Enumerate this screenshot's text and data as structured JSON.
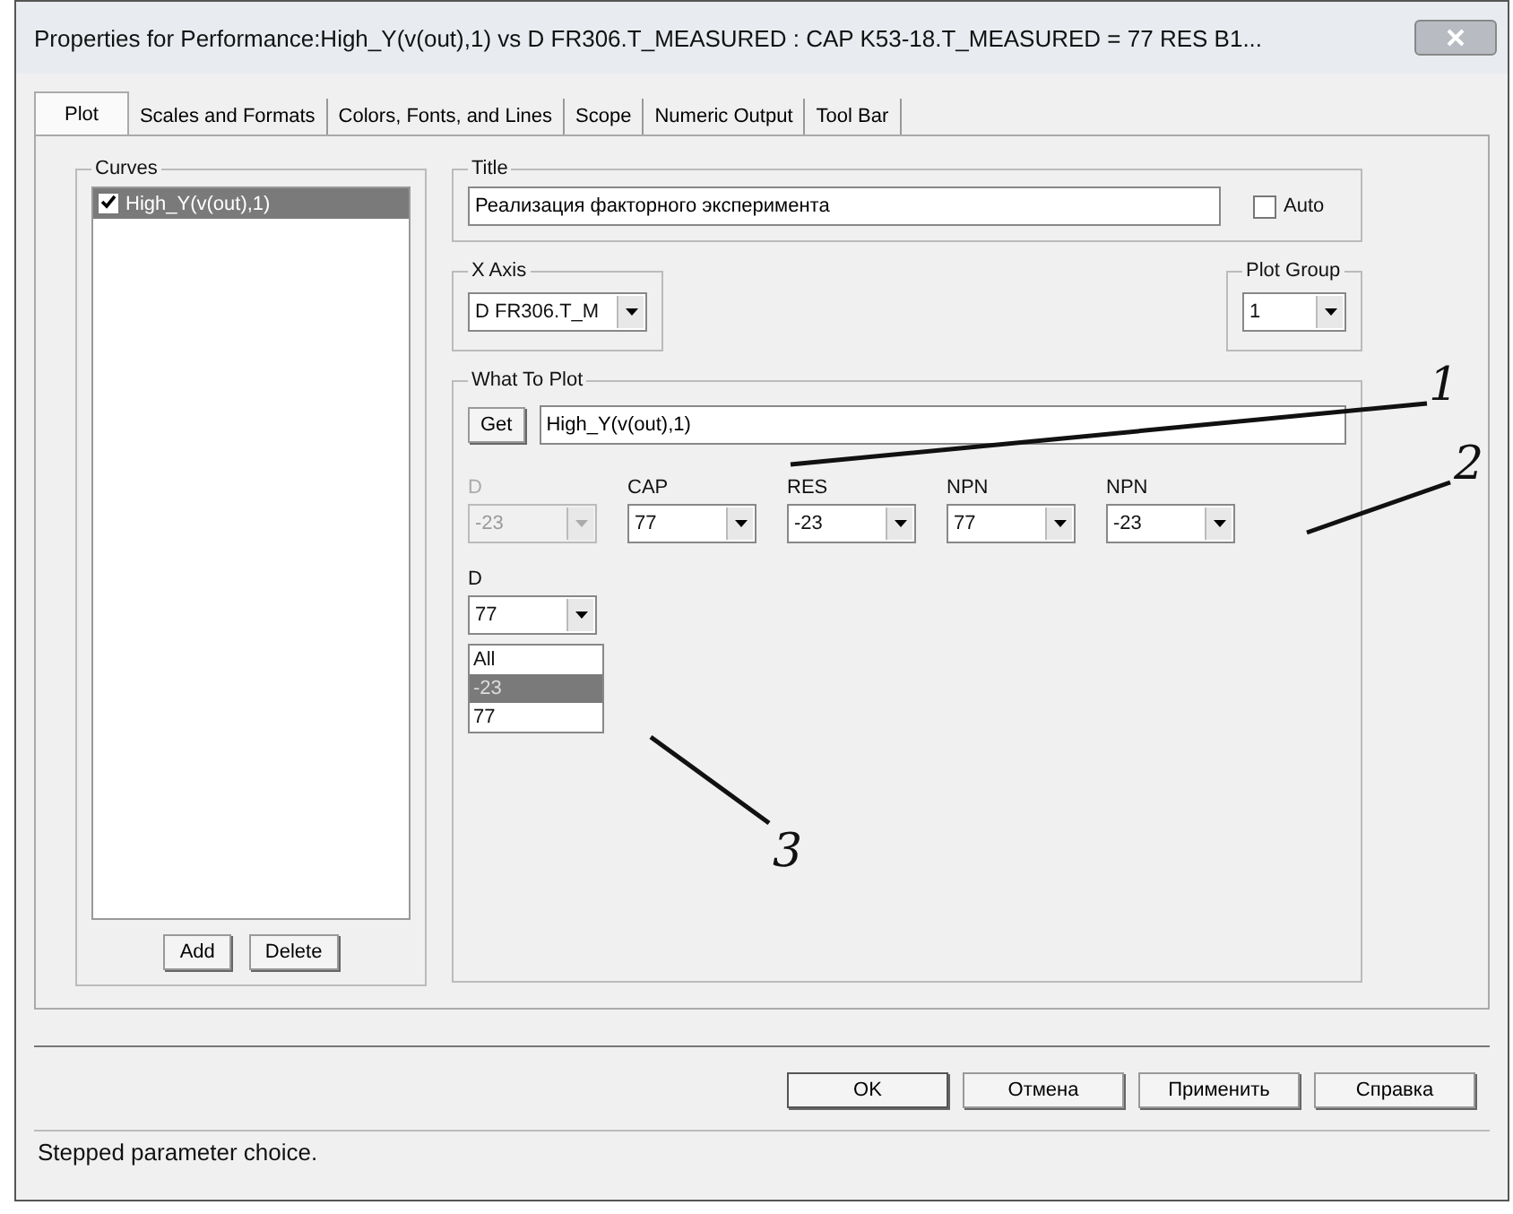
{
  "window": {
    "title": "Properties for Performance:High_Y(v(out),1) vs D FR306.T_MEASURED : CAP K53-18.T_MEASURED = 77 RES B1..."
  },
  "tabs": [
    {
      "label": "Plot",
      "selected": true
    },
    {
      "label": "Scales and Formats",
      "selected": false
    },
    {
      "label": "Colors, Fonts, and Lines",
      "selected": false
    },
    {
      "label": "Scope",
      "selected": false
    },
    {
      "label": "Numeric Output",
      "selected": false
    },
    {
      "label": "Tool Bar",
      "selected": false
    }
  ],
  "curves": {
    "label": "Curves",
    "items": [
      {
        "label": "High_Y(v(out),1)",
        "checked": true,
        "selected": true
      }
    ],
    "buttons": [
      "Add",
      "Delete"
    ]
  },
  "title_group": {
    "label": "Title",
    "value": "Реализация факторного эксперимента",
    "auto": {
      "label": "Auto",
      "checked": false
    }
  },
  "x_axis": {
    "label": "X Axis",
    "value": "D FR306.T_M"
  },
  "plot_group": {
    "label": "Plot Group",
    "value": "1"
  },
  "what_to_plot": {
    "label": "What To Plot",
    "get_button": "Get",
    "expression": "High_Y(v(out),1)",
    "parameters": [
      {
        "label": "D",
        "value": "-23",
        "disabled": true
      },
      {
        "label": "CAP",
        "value": "77",
        "disabled": false
      },
      {
        "label": "RES",
        "value": "-23",
        "disabled": false
      },
      {
        "label": "NPN",
        "value": "77",
        "disabled": false
      },
      {
        "label": "NPN",
        "value": "-23",
        "disabled": false
      }
    ],
    "open_parameter": {
      "label": "D",
      "value": "77",
      "options": [
        {
          "label": "All",
          "highlighted": false
        },
        {
          "label": "-23",
          "highlighted": true
        },
        {
          "label": "77",
          "highlighted": false
        }
      ]
    }
  },
  "annotations": [
    "1",
    "2",
    "3"
  ],
  "buttons": [
    "OK",
    "Отмена",
    "Применить",
    "Справка"
  ],
  "status_bar": "Stepped parameter choice."
}
